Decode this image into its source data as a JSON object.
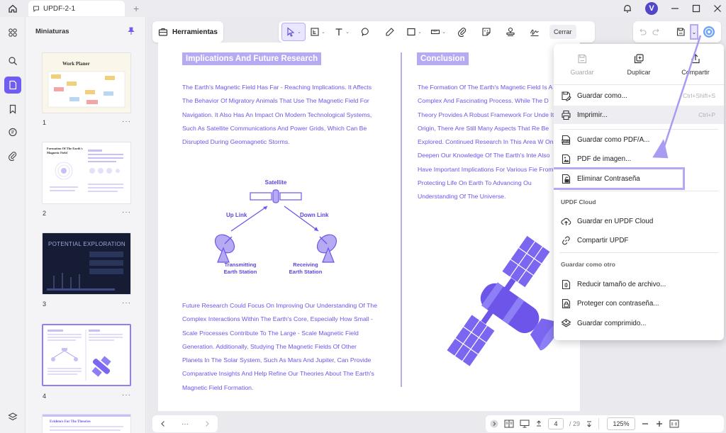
{
  "tab": {
    "title": "UPDF-2-1"
  },
  "user": {
    "initial": "V"
  },
  "sidebar": {
    "title": "Miniaturas"
  },
  "thumbnails": [
    {
      "number": "1",
      "caption": "Work Planer"
    },
    {
      "number": "2",
      "caption": "Formation Of The Earth's Magnetic Field"
    },
    {
      "number": "3",
      "caption": "POTENTIAL EXPLORATION"
    },
    {
      "number": "4",
      "caption": ""
    },
    {
      "number": "",
      "caption": "Evidence For The Theories"
    }
  ],
  "toolbar": {
    "tools_label": "Herramientas",
    "close_label": "Cerrar"
  },
  "document": {
    "left_title": "Implications And Future Research",
    "left_para1": "The Earth's Magnetic Field Has Far - Reaching Implications. It Affects The Behavior Of Migratory Animals That Use The Magnetic Field For Navigation. It Also Has An Impact On Modern Technological Systems, Such As Satellite Communications And Power Grids, Which Can Be Disrupted During Geomagnetic Storms.",
    "diagram": {
      "satellite": "Satellite",
      "uplink": "Up Link",
      "downlink": "Down Link",
      "transmit1": "Transmitting",
      "transmit2": "Earth Station",
      "receive1": "Receiving",
      "receive2": "Earth Station"
    },
    "left_para2": "Future Research Could Focus On Improving Our Understanding Of The Complex Interactions Within The Earth's Core, Especially How Small - Scale Processes Contribute To The Large - Scale Magnetic Field Generation. Additionally, Studying The Magnetic Fields Of Other Planets In The Solar System, Such As Mars And Jupiter, Can Provide Comparative Insights And Help Refine Our Theories About The Earth's Magnetic Field Formation.",
    "right_title": "Conclusion",
    "right_para": "The Formation Of The Earth's Magnetic Field Is A Complex And Fascinating Process. While The D Theory Provides A Robust Framework For Unde Its Origin, There Are Still Many Aspects That Re Be Explored. Continued Research In This Area W Only Deepen Our Knowledge Of The Earth's Inte Also Have Important Implications For Various Fie From Protecting Life On Earth To Advancing Ou Understanding Of The Universe."
  },
  "bottombar": {
    "more": "···",
    "current_page": "4",
    "total_pages": "/ 29",
    "zoom": "125%"
  },
  "menu": {
    "top": [
      {
        "label": "Guardar",
        "icon": "save-icon",
        "disabled": true
      },
      {
        "label": "Duplicar",
        "icon": "duplicate-icon",
        "disabled": false
      },
      {
        "label": "Compartir",
        "icon": "share-icon",
        "disabled": false
      }
    ],
    "items": [
      {
        "label": "Guardar como...",
        "shortcut": "Ctrl+Shift+S"
      },
      {
        "label": "Imprimir...",
        "shortcut": "Ctrl+P"
      },
      {
        "label": "Guardar como PDF/A...",
        "shortcut": ""
      },
      {
        "label": "PDF de imagen...",
        "shortcut": ""
      },
      {
        "label": "Eliminar Contraseña",
        "shortcut": ""
      }
    ],
    "cloud_header": "UPDF Cloud",
    "cloud_items": [
      {
        "label": "Guardar en UPDF Cloud"
      },
      {
        "label": "Compartir UPDF"
      }
    ],
    "other_header": "Guardar como otro",
    "other_items": [
      {
        "label": "Reducir tamaño de archivo..."
      },
      {
        "label": "Proteger con contraseña..."
      },
      {
        "label": "Guardar comprimido..."
      }
    ]
  },
  "colors": {
    "accent": "#6f5cf0",
    "doc_text": "#6d55ea",
    "title_bg": "#b6abf3",
    "highlight": "#b6a8f5"
  }
}
